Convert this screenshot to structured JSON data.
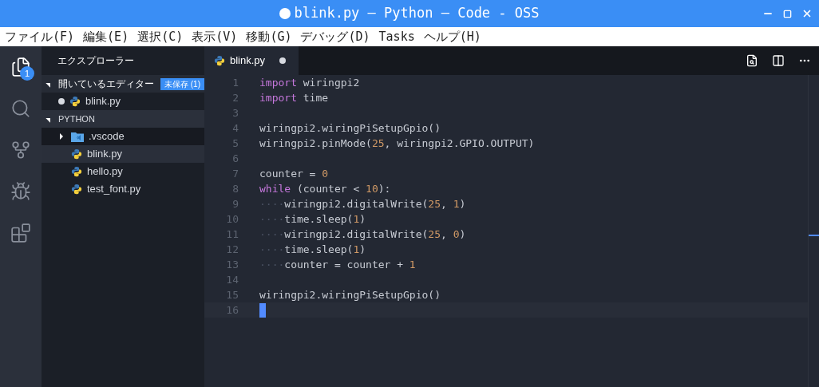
{
  "window": {
    "title": "blink.py — Python — Code - OSS",
    "dirty": true
  },
  "menu": [
    "ファイル(F)",
    "編集(E)",
    "選択(C)",
    "表示(V)",
    "移動(G)",
    "デバッグ(D)",
    "Tasks",
    "ヘルプ(H)"
  ],
  "activity_bar": [
    {
      "kind": "files",
      "selected": true,
      "badge": "1"
    },
    {
      "kind": "search",
      "selected": false
    },
    {
      "kind": "git",
      "selected": false
    },
    {
      "kind": "debug",
      "selected": false
    },
    {
      "kind": "extensions",
      "selected": false
    }
  ],
  "sidebar": {
    "title": "エクスプローラー",
    "open_editors": {
      "label": "開いているエディター",
      "badge": "未保存 (1)",
      "expanded": true,
      "items": [
        {
          "name": "blink.py",
          "dirty": true
        }
      ]
    },
    "folder": {
      "label": "PYTHON",
      "expanded": true,
      "children": [
        {
          "name": ".vscode",
          "kind": "folder",
          "expanded": false,
          "selected": false
        },
        {
          "name": "blink.py",
          "kind": "python",
          "selected": true
        },
        {
          "name": "hello.py",
          "kind": "python",
          "selected": false
        },
        {
          "name": "test_font.py",
          "kind": "python",
          "selected": false
        }
      ]
    }
  },
  "editor": {
    "tabs": [
      {
        "name": "blink.py",
        "dirty": true,
        "selected": true
      }
    ],
    "lines": [
      {
        "number": "1",
        "cursor": false,
        "tokens": [
          {
            "kind": "keyword",
            "text": "import"
          },
          {
            "kind": "plain",
            "text": " wiringpi2"
          }
        ]
      },
      {
        "number": "2",
        "cursor": false,
        "tokens": [
          {
            "kind": "keyword",
            "text": "import"
          },
          {
            "kind": "plain",
            "text": " time"
          }
        ]
      },
      {
        "number": "3",
        "cursor": false
      },
      {
        "number": "4",
        "cursor": false,
        "tokens": [
          {
            "kind": "plain",
            "text": "wiringpi2.wiringPiSetupGpio()"
          }
        ]
      },
      {
        "number": "5",
        "cursor": false,
        "tokens": [
          {
            "kind": "plain",
            "text": "wiringpi2.pinMode("
          },
          {
            "kind": "number",
            "text": "25"
          },
          {
            "kind": "plain",
            "text": ", wiringpi2.GPIO.OUTPUT)"
          }
        ]
      },
      {
        "number": "6",
        "cursor": false
      },
      {
        "number": "7",
        "cursor": false,
        "tokens": [
          {
            "kind": "plain",
            "text": "counter = "
          },
          {
            "kind": "number",
            "text": "0"
          }
        ]
      },
      {
        "number": "8",
        "cursor": false,
        "tokens": [
          {
            "kind": "keyword",
            "text": "while"
          },
          {
            "kind": "plain",
            "text": " (counter < "
          },
          {
            "kind": "number",
            "text": "10"
          },
          {
            "kind": "plain",
            "text": "):"
          }
        ]
      },
      {
        "number": "9",
        "cursor": false,
        "tokens": [
          {
            "kind": "whitespace",
            "text": "····"
          },
          {
            "kind": "plain",
            "text": "wiringpi2.digitalWrite("
          },
          {
            "kind": "number",
            "text": "25"
          },
          {
            "kind": "plain",
            "text": ", "
          },
          {
            "kind": "number",
            "text": "1"
          },
          {
            "kind": "plain",
            "text": ")"
          }
        ]
      },
      {
        "number": "10",
        "cursor": false,
        "tokens": [
          {
            "kind": "whitespace",
            "text": "····"
          },
          {
            "kind": "plain",
            "text": "time.sleep("
          },
          {
            "kind": "number",
            "text": "1"
          },
          {
            "kind": "plain",
            "text": ")"
          }
        ]
      },
      {
        "number": "11",
        "cursor": false,
        "tokens": [
          {
            "kind": "whitespace",
            "text": "····"
          },
          {
            "kind": "plain",
            "text": "wiringpi2.digitalWrite("
          },
          {
            "kind": "number",
            "text": "25"
          },
          {
            "kind": "plain",
            "text": ", "
          },
          {
            "kind": "number",
            "text": "0"
          },
          {
            "kind": "plain",
            "text": ")"
          }
        ]
      },
      {
        "number": "12",
        "cursor": false,
        "tokens": [
          {
            "kind": "whitespace",
            "text": "····"
          },
          {
            "kind": "plain",
            "text": "time.sleep("
          },
          {
            "kind": "number",
            "text": "1"
          },
          {
            "kind": "plain",
            "text": ")"
          }
        ]
      },
      {
        "number": "13",
        "cursor": false,
        "tokens": [
          {
            "kind": "whitespace",
            "text": "····"
          },
          {
            "kind": "plain",
            "text": "counter = counter + "
          },
          {
            "kind": "number",
            "text": "1"
          }
        ]
      },
      {
        "number": "14",
        "cursor": false
      },
      {
        "number": "15",
        "cursor": false,
        "tokens": [
          {
            "kind": "plain",
            "text": "wiringpi2.wiringPiSetupGpio()"
          }
        ]
      },
      {
        "number": "16",
        "cursor": true
      }
    ]
  }
}
